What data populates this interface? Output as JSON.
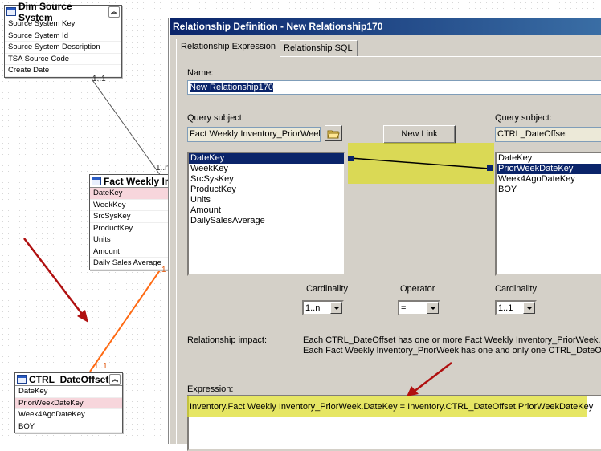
{
  "diagram": {
    "dim_source": {
      "title": "Dim Source System",
      "fields": [
        "Source System Key",
        "Source System Id",
        "Source System Description",
        "TSA Source Code",
        "Create Date"
      ]
    },
    "fact_weekly": {
      "title": "Fact Weekly Inv",
      "fields": [
        "DateKey",
        "WeekKey",
        "SrcSysKey",
        "ProductKey",
        "Units",
        "Amount",
        "Daily Sales Average"
      ]
    },
    "ctrl_dateoffset": {
      "title": "CTRL_DateOffset",
      "fields": [
        "DateKey",
        "PriorWeekDateKey",
        "Week4AgoDateKey",
        "BOY"
      ]
    },
    "cardinality_labels": {
      "dim_to_fact_top": "1..1",
      "dim_to_fact_bottom": "1..n",
      "fact_side": "1",
      "ctrl_side": "1..1"
    },
    "colors": {
      "connector_orange": "#ff6a13",
      "arrow_red": "#b01010",
      "highlight": "#dcdc28"
    }
  },
  "dialog": {
    "title": "Relationship Definition - New Relationship170",
    "tabs": [
      "Relationship Expression",
      "Relationship SQL"
    ],
    "name_label": "Name:",
    "name_value": "New Relationship170",
    "left_query_label": "Query subject:",
    "left_query_value": "Fact Weekly Inventory_PriorWeek",
    "new_link_label": "New Link",
    "right_query_label": "Query subject:",
    "right_query_value": "CTRL_DateOffset",
    "left_items": [
      "DateKey",
      "WeekKey",
      "SrcSysKey",
      "ProductKey",
      "Units",
      "Amount",
      "DailySalesAverage"
    ],
    "right_items": [
      "DateKey",
      "PriorWeekDateKey",
      "Week4AgoDateKey",
      "BOY"
    ],
    "left_cardinality_label": "Cardinality",
    "left_cardinality_value": "1..n",
    "operator_label": "Operator",
    "operator_value": "=",
    "right_cardinality_label": "Cardinality",
    "right_cardinality_value": "1..1",
    "impact_label": "Relationship impact:",
    "impact_line1": "Each CTRL_DateOffset has one or more Fact Weekly Inventory_PriorWeek.",
    "impact_line2": "Each Fact Weekly Inventory_PriorWeek has one and only one CTRL_DateOffset.",
    "expression_label": "Expression:",
    "expression_value": "Inventory.Fact Weekly Inventory_PriorWeek.DateKey = Inventory.CTRL_DateOffset.PriorWeekDateKey"
  }
}
